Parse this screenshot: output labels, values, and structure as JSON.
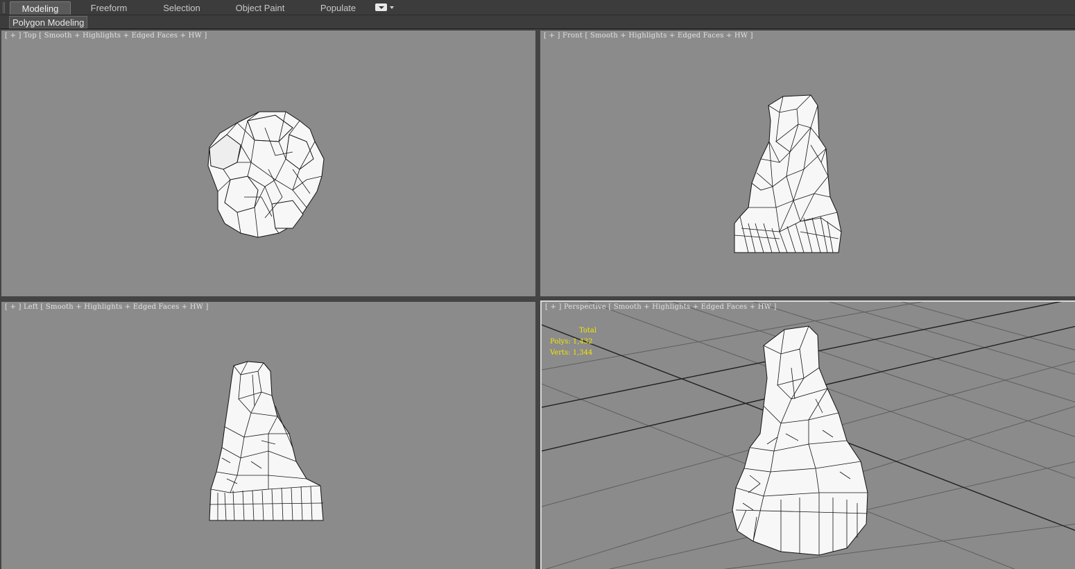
{
  "ribbon": {
    "tabs": [
      {
        "label": "Modeling",
        "active": true
      },
      {
        "label": "Freeform",
        "active": false
      },
      {
        "label": "Selection",
        "active": false
      },
      {
        "label": "Object Paint",
        "active": false
      },
      {
        "label": "Populate",
        "active": false
      }
    ],
    "dropdown_icon": "ribbon-options-icon",
    "panel_label": "Polygon Modeling"
  },
  "viewports": {
    "top": {
      "plus": "[ + ]",
      "view": "Top",
      "shading": "[ Smooth + Highlights + Edged Faces + HW ]"
    },
    "front": {
      "plus": "[ + ]",
      "view": "Front",
      "shading": "[ Smooth + Highlights + Edged Faces + HW ]"
    },
    "left": {
      "plus": "[ + ]",
      "view": "Left",
      "shading": "[ Smooth + Highlights + Edged Faces + HW ]"
    },
    "perspective": {
      "plus": "[ + ]",
      "view": "Perspective",
      "shading": "[ Smooth + Highlights + Edged Faces + HW ]"
    }
  },
  "statistics": {
    "header": "Total",
    "polys_label": "Polys:",
    "polys_value": "1,432",
    "verts_label": "Verts:",
    "verts_value": "1,344"
  },
  "colors": {
    "viewport_bg": "#8b8b8b",
    "ui_bg": "#3c3c3c",
    "stats_text": "#f2e600",
    "active_viewport_border": "#d8d8d8"
  }
}
